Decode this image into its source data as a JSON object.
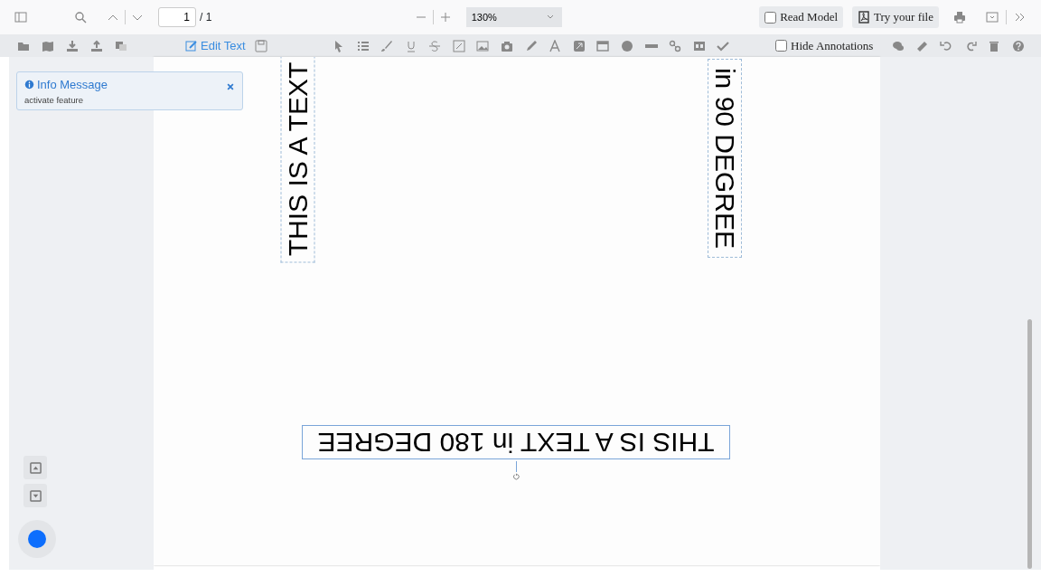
{
  "toolbar": {
    "page_number": "1",
    "page_count": "/ 1",
    "zoom": "130%",
    "read_model": {
      "label": "Read Model",
      "checked": false
    },
    "try_file": "Try your file"
  },
  "edit_toolbar": {
    "edit_text": "Edit Text",
    "hide_annotations": {
      "label": "Hide Annotations",
      "checked": false
    }
  },
  "info_message": {
    "title": "Info Message",
    "text": "activate feature"
  },
  "page_texts": [
    {
      "text": "THIS IS A TEXT",
      "kind": "up",
      "selected": false
    },
    {
      "text": "in 90 DEGREE",
      "kind": "down",
      "selected": false
    },
    {
      "text": "THIS IS A TEXT in 180 DEGREE",
      "kind": "flipped",
      "selected": true
    }
  ]
}
